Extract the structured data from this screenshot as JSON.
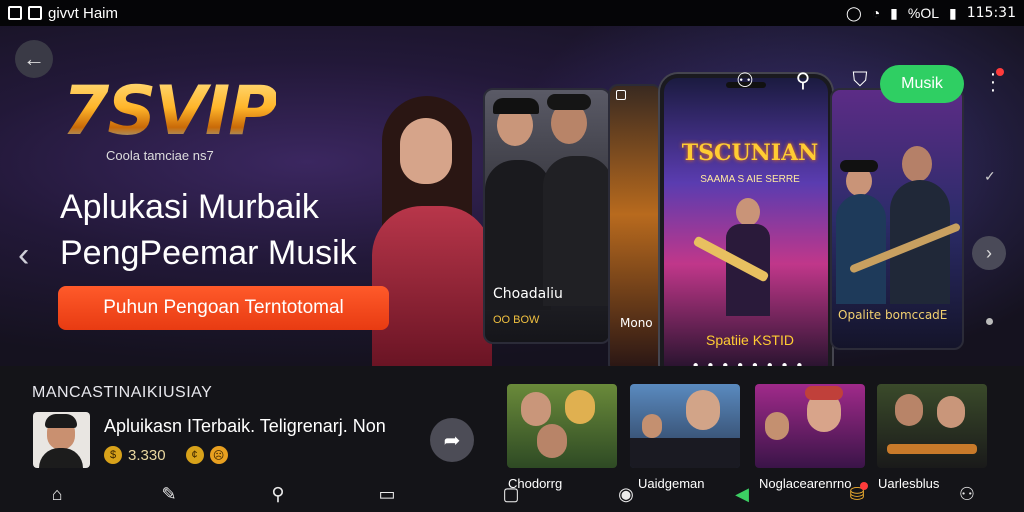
{
  "status_bar": {
    "app_label": "givvt Haim",
    "battery": "%OL",
    "time": "115:31"
  },
  "hero": {
    "brand": "7SVIP",
    "brand_sub": "Coola tamciae ns7",
    "title_line1": "Aplukasi Murbaik",
    "title_line2": "PengPeemar Musik",
    "cta_label": "Puhun Pengoan Terntotomal",
    "musik_label": "Musik",
    "card_a_label": "Choadaliu",
    "card_a_sub": "OO BOW",
    "card_b_label": "Mono",
    "phone_title": "TSCUNIAN",
    "phone_sub": "SAAMA S AIE SERRE",
    "phone_foot": "Spatiie KSTID",
    "phone_dots": "● ● ● ● ● ● ● ●",
    "card_c_label": "Opalite bomccadE"
  },
  "section": {
    "title": "MANCASTINAIKIUSIAY"
  },
  "featured_app": {
    "name": "Apluikasn ITerbaik. Teligrenarj. Non",
    "price": "3.330"
  },
  "thumbnails": [
    {
      "label": "Chodorrg"
    },
    {
      "label": "Uaidgeman"
    },
    {
      "label": "Noglacearenrno"
    },
    {
      "label": "Uarlesblus"
    }
  ],
  "icons": {
    "back": "arrow-left-icon",
    "user": "user-icon",
    "search": "search-icon",
    "shield": "shield-icon",
    "menu": "kebab-menu-icon",
    "share": "share-icon"
  },
  "colors": {
    "accent_green": "#2fcf63",
    "cta_orange": "#ff5a2a",
    "logo_gold": "#ffb52a"
  }
}
